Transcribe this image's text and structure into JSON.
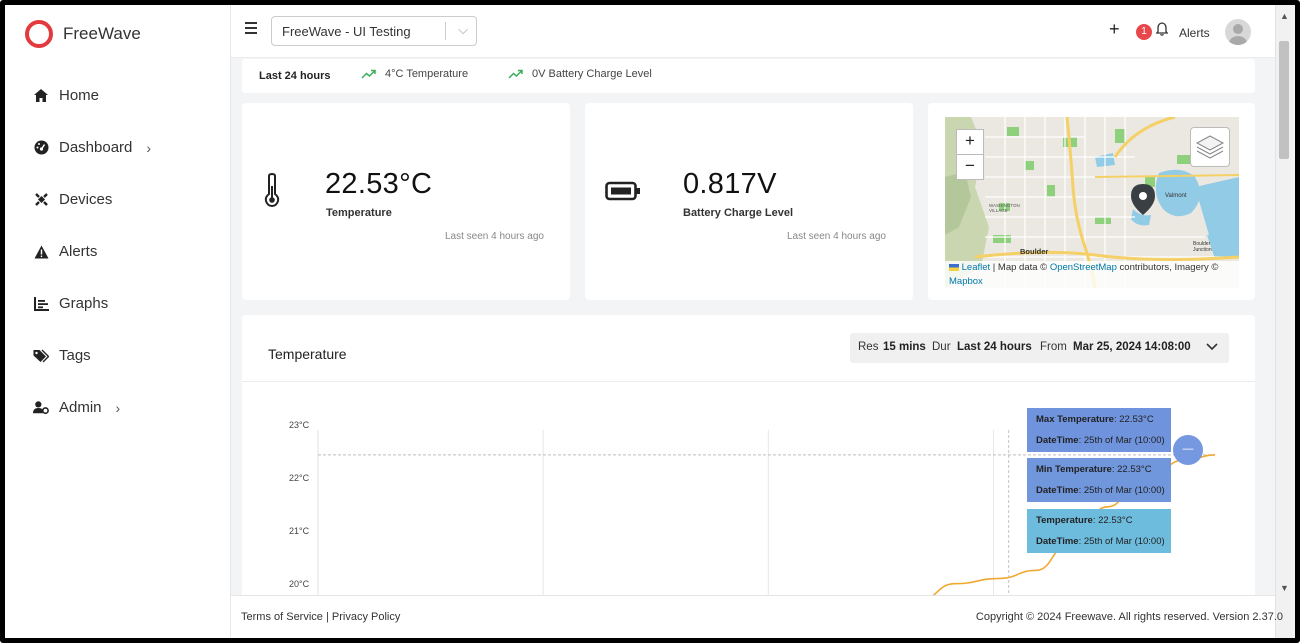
{
  "app": {
    "name": "FreeWave"
  },
  "sidebar": {
    "items": [
      {
        "label": "Home",
        "icon": "home-icon"
      },
      {
        "label": "Dashboard",
        "icon": "dashboard-icon",
        "chevron": "›"
      },
      {
        "label": "Devices",
        "icon": "devices-icon"
      },
      {
        "label": "Alerts",
        "icon": "warning-icon"
      },
      {
        "label": "Graphs",
        "icon": "graph-icon"
      },
      {
        "label": "Tags",
        "icon": "tags-icon"
      },
      {
        "label": "Admin",
        "icon": "admin-icon",
        "chevron": "›"
      }
    ]
  },
  "header": {
    "org_select": "FreeWave - UI Testing",
    "add_label": "+",
    "alert_count": "1",
    "alerts_label": "Alerts"
  },
  "strip": {
    "period": "Last 24 hours",
    "temperature": "4°C Temperature",
    "battery": "0V Battery Charge Level"
  },
  "cards": {
    "temperature": {
      "value": "22.53°C",
      "label": "Temperature",
      "seen": "Last seen 4 hours ago"
    },
    "battery": {
      "value": "0.817V",
      "label": "Battery Charge Level",
      "seen": "Last seen 4 hours ago"
    }
  },
  "map": {
    "zoom_in": "+",
    "zoom_out": "−",
    "labels": {
      "city": "Boulder",
      "valmont": "Valmont",
      "junction": "Boulder\nJunction",
      "village": "WASHINGTON\nVILLAGE"
    },
    "attribution": {
      "leaflet": "Leaflet",
      "text1": " | Map data © ",
      "osm": "OpenStreetMap",
      "text2": " contributors, Imagery ©",
      "mapbox": "Mapbox"
    }
  },
  "chart_panel": {
    "title": "Temperature",
    "res_label": "Res",
    "res_value": "15 mins",
    "dur_label": "Dur",
    "dur_value": "Last 24 hours",
    "from_label": "From",
    "from_value": "Mar 25, 2024 14:08:00",
    "tooltips": [
      {
        "name_label": "Max Temperature",
        "value": ": 22.53°C",
        "dt_label": "DateTime",
        "dt_value": ": 25th of Mar (10:00)",
        "color": "#6f93dc"
      },
      {
        "name_label": "Min Temperature",
        "value": ": 22.53°C",
        "dt_label": "DateTime",
        "dt_value": ": 25th of Mar (10:00)",
        "color": "#7096dc"
      },
      {
        "name_label": "Temperature",
        "value": ": 22.53°C",
        "dt_label": "DateTime",
        "dt_value": ": 25th of Mar (10:00)",
        "color": "#6ebcdd"
      }
    ],
    "reset_zoom": "—"
  },
  "chart_data": {
    "type": "line",
    "ylabel": "",
    "y_ticks": [
      "23°C",
      "22°C",
      "21°C",
      "20°C"
    ],
    "ylim": [
      19.75,
      23
    ],
    "series": [
      {
        "values": [
          {
            "t": 0.67,
            "v": 19.78
          },
          {
            "t": 0.71,
            "v": 20.1
          },
          {
            "t": 0.76,
            "v": 20.2
          },
          {
            "t": 0.8,
            "v": 20.35
          },
          {
            "t": 0.84,
            "v": 20.9
          },
          {
            "t": 0.88,
            "v": 21.55
          },
          {
            "t": 0.92,
            "v": 22.1
          },
          {
            "t": 0.97,
            "v": 22.45
          },
          {
            "t": 1.0,
            "v": 22.53
          }
        ]
      }
    ],
    "line_color": "#f0a830",
    "crosshair_value": 22.53
  },
  "footer": {
    "terms": "Terms of Service",
    "sep": " | ",
    "privacy": "Privacy Policy",
    "copyright": "Copyright © 2024 Freewave. All rights reserved. Version 2.37.0"
  }
}
